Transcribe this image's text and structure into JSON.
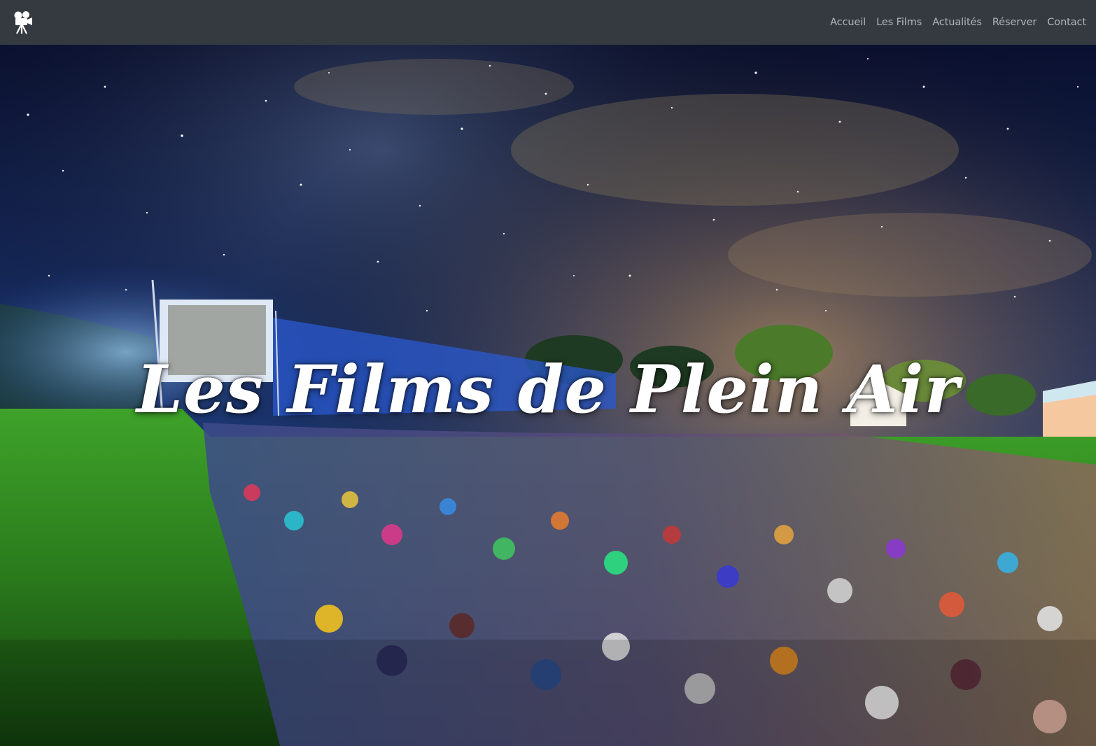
{
  "navbar": {
    "brand_icon": "movie-camera-icon",
    "links": [
      {
        "label": "Accueil"
      },
      {
        "label": "Les Films"
      },
      {
        "label": "Actualités"
      },
      {
        "label": "Réserver"
      },
      {
        "label": "Contact"
      }
    ],
    "background": "#343a40",
    "link_color": "#bfc1c3"
  },
  "hero": {
    "title": "Les Films de Plein Air",
    "image": "night-open-air-cinema-photo",
    "colors": {
      "sky_top": "#0a1030",
      "sky_glow": "#d9a35a",
      "grass": "#2f8a1e",
      "screen": "#dfe8f5"
    }
  }
}
